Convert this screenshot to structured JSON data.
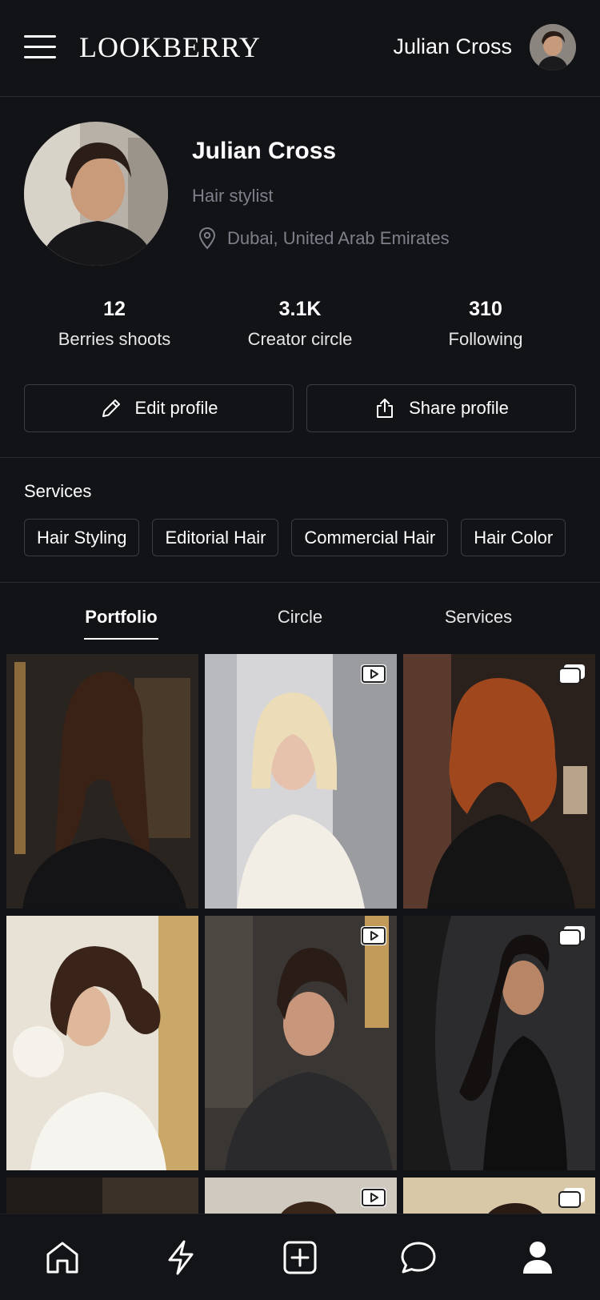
{
  "header": {
    "logo": "LOOKBERRY",
    "user_name": "Julian Cross"
  },
  "profile": {
    "name": "Julian Cross",
    "role": "Hair stylist",
    "location": "Dubai, United Arab Emirates"
  },
  "stats": [
    {
      "value": "12",
      "label": "Berries shoots"
    },
    {
      "value": "3.1K",
      "label": "Creator circle"
    },
    {
      "value": "310",
      "label": "Following"
    }
  ],
  "actions": {
    "edit_label": "Edit profile",
    "share_label": "Share profile"
  },
  "services": {
    "title": "Services",
    "chips": [
      "Hair Styling",
      "Editorial Hair",
      "Commercial Hair",
      "Hair Color"
    ]
  },
  "tabs": [
    {
      "label": "Portfolio",
      "active": true
    },
    {
      "label": "Circle",
      "active": false
    },
    {
      "label": "Services",
      "active": false
    }
  ],
  "portfolio": [
    {
      "kind": "photo",
      "badge": "none"
    },
    {
      "kind": "photo",
      "badge": "video"
    },
    {
      "kind": "photo",
      "badge": "gallery"
    },
    {
      "kind": "photo",
      "badge": "none"
    },
    {
      "kind": "photo",
      "badge": "video"
    },
    {
      "kind": "photo",
      "badge": "gallery"
    },
    {
      "kind": "photo",
      "badge": "none"
    },
    {
      "kind": "photo",
      "badge": "video"
    },
    {
      "kind": "photo",
      "badge": "gallery"
    }
  ],
  "bottom_nav": [
    {
      "icon": "home-icon"
    },
    {
      "icon": "bolt-icon"
    },
    {
      "icon": "add-icon"
    },
    {
      "icon": "chat-icon"
    },
    {
      "icon": "profile-icon",
      "active": true
    }
  ],
  "colors": {
    "background": "#121317",
    "border": "#3a3c43",
    "muted_text": "#7d8089"
  }
}
